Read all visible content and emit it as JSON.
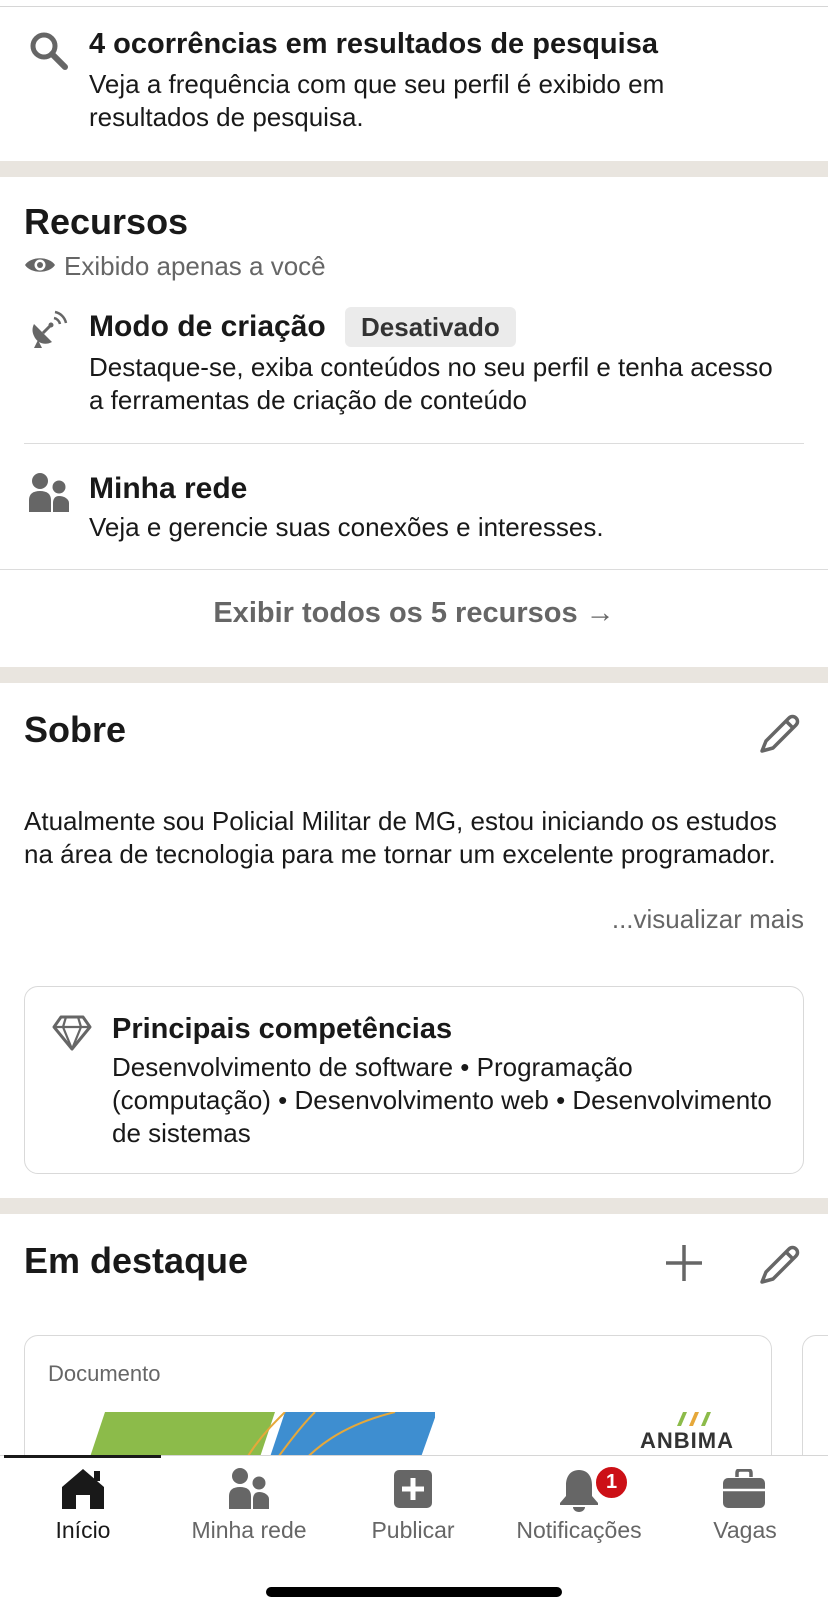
{
  "search_appearances": {
    "title": "4 ocorrências em resultados de pesquisa",
    "description": "Veja a frequência com que seu perfil é exibido em resultados de pesquisa."
  },
  "resources": {
    "title": "Recursos",
    "visibility": "Exibido apenas a você",
    "items": [
      {
        "title": "Modo de criação",
        "badge": "Desativado",
        "description": "Destaque-se, exiba conteúdos no seu perfil e tenha acesso a ferramentas de criação de conteúdo",
        "icon": "satellite-dish-icon"
      },
      {
        "title": "Minha rede",
        "description": "Veja e gerencie suas conexões e interesses.",
        "icon": "people-icon"
      }
    ],
    "show_all": "Exibir todos os 5 recursos →"
  },
  "about": {
    "title": "Sobre",
    "text": "Atualmente sou Policial Militar de MG, estou iniciando os estudos na área de tecnologia para me tornar um excelente programador.",
    "see_more": "...visualizar mais",
    "skills": {
      "title": "Principais competências",
      "text": "Desenvolvimento de software • Programação (computação) • Desenvolvimento web • Desenvolvimento de sistemas"
    }
  },
  "featured": {
    "title": "Em destaque",
    "card_type": "Documento",
    "card_logo_text": "ANBIMA"
  },
  "bottom_nav": {
    "items": [
      {
        "label": "Início",
        "icon": "home-icon",
        "active": true
      },
      {
        "label": "Minha rede",
        "icon": "people-icon"
      },
      {
        "label": "Publicar",
        "icon": "plus-square-icon"
      },
      {
        "label": "Notificações",
        "icon": "bell-icon",
        "badge": "1"
      },
      {
        "label": "Vagas",
        "icon": "briefcase-icon"
      }
    ]
  },
  "colors": {
    "separator": "#e9e5df",
    "muted_text": "#666666",
    "notification_badge": "#cc1016",
    "primary_text": "#191919"
  }
}
